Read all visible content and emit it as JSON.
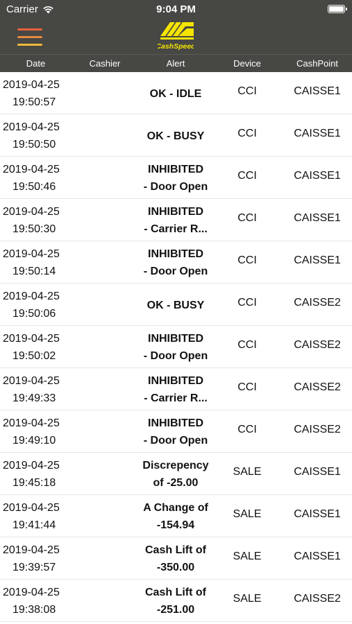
{
  "status": {
    "carrier": "Carrier",
    "time": "9:04 PM",
    "battery_level": 1.0
  },
  "nav": {
    "logo_text": "CashSpeed"
  },
  "columns": {
    "date": "Date",
    "cashier": "Cashier",
    "alert": "Alert",
    "device": "Device",
    "cashpoint": "CashPoint"
  },
  "rows": [
    {
      "date": "2019-04-25",
      "time": "19:50:57",
      "alert1": "OK - IDLE",
      "alert2": "",
      "device": "CCI",
      "cashpoint": "CAISSE1"
    },
    {
      "date": "2019-04-25",
      "time": "19:50:50",
      "alert1": "OK - BUSY",
      "alert2": "",
      "device": "CCI",
      "cashpoint": "CAISSE1"
    },
    {
      "date": "2019-04-25",
      "time": "19:50:46",
      "alert1": "INHIBITED",
      "alert2": "- Door Open",
      "device": "CCI",
      "cashpoint": "CAISSE1"
    },
    {
      "date": "2019-04-25",
      "time": "19:50:30",
      "alert1": "INHIBITED",
      "alert2": "- Carrier R...",
      "device": "CCI",
      "cashpoint": "CAISSE1"
    },
    {
      "date": "2019-04-25",
      "time": "19:50:14",
      "alert1": "INHIBITED",
      "alert2": "- Door Open",
      "device": "CCI",
      "cashpoint": "CAISSE1"
    },
    {
      "date": "2019-04-25",
      "time": "19:50:06",
      "alert1": "OK - BUSY",
      "alert2": "",
      "device": "CCI",
      "cashpoint": "CAISSE2"
    },
    {
      "date": "2019-04-25",
      "time": "19:50:02",
      "alert1": "INHIBITED",
      "alert2": "- Door Open",
      "device": "CCI",
      "cashpoint": "CAISSE2"
    },
    {
      "date": "2019-04-25",
      "time": "19:49:33",
      "alert1": "INHIBITED",
      "alert2": "- Carrier R...",
      "device": "CCI",
      "cashpoint": "CAISSE2"
    },
    {
      "date": "2019-04-25",
      "time": "19:49:10",
      "alert1": "INHIBITED",
      "alert2": "- Door Open",
      "device": "CCI",
      "cashpoint": "CAISSE2"
    },
    {
      "date": "2019-04-25",
      "time": "19:45:18",
      "alert1": "Discrepency",
      "alert2": "of -25.00",
      "device": "SALE",
      "cashpoint": "CAISSE1"
    },
    {
      "date": "2019-04-25",
      "time": "19:41:44",
      "alert1": "A Change of",
      "alert2": "-154.94",
      "device": "SALE",
      "cashpoint": "CAISSE1"
    },
    {
      "date": "2019-04-25",
      "time": "19:39:57",
      "alert1": "Cash Lift of",
      "alert2": "-350.00",
      "device": "SALE",
      "cashpoint": "CAISSE1"
    },
    {
      "date": "2019-04-25",
      "time": "19:38:08",
      "alert1": "Cash Lift of",
      "alert2": "-251.00",
      "device": "SALE",
      "cashpoint": "CAISSE2"
    }
  ],
  "colors": {
    "bar": "#474744",
    "menu_top": "#e8623a",
    "menu_mid": "#e58a3c",
    "menu_bottom": "#f0b93a",
    "logo": "#f5e400"
  },
  "icons": {
    "menu": "hamburger-icon",
    "wifi": "wifi-icon",
    "battery": "battery-icon",
    "logo": "cashspeed-logo"
  }
}
